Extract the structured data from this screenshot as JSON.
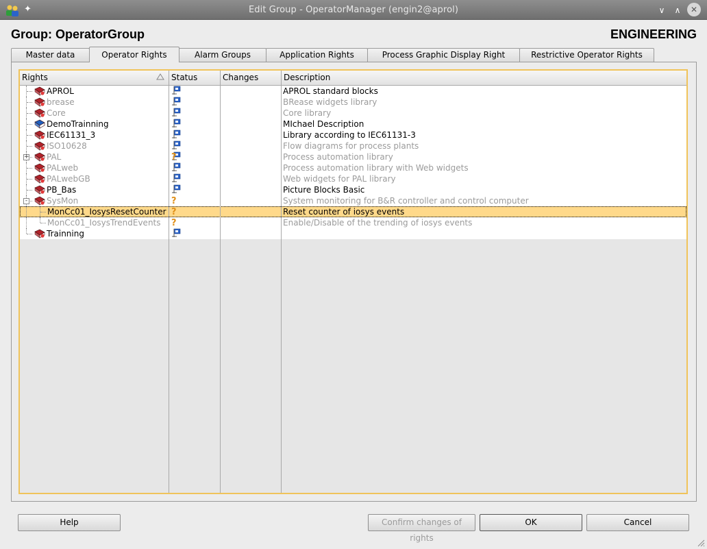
{
  "window": {
    "title": "Edit Group - OperatorManager (engin2@aprol)",
    "app_icon": "users-icon",
    "pin_icon": "pin-icon",
    "minimize_icon": "chevron-down-icon",
    "maximize_icon": "chevron-up-icon",
    "close_icon": "close-icon"
  },
  "header": {
    "group_title": "Group: OperatorGroup",
    "right_label": "ENGINEERING"
  },
  "tabs": [
    {
      "label": "Master data",
      "active": false
    },
    {
      "label": "Operator Rights",
      "active": true
    },
    {
      "label": "Alarm Groups",
      "active": false
    },
    {
      "label": "Application Rights",
      "active": false
    },
    {
      "label": "Process Graphic Display Right",
      "active": false
    },
    {
      "label": "Restrictive Operator Rights",
      "active": false
    }
  ],
  "table": {
    "columns": [
      "Rights",
      "Status",
      "Changes",
      "Description"
    ],
    "sort_column": "Rights",
    "rows": [
      {
        "name": "APROL",
        "status": "flag",
        "changes": "",
        "description": "APROL standard blocks",
        "greyed": false,
        "icon": "red-book-icon"
      },
      {
        "name": "brease",
        "status": "flag",
        "changes": "",
        "description": "BRease widgets library",
        "greyed": true,
        "icon": "red-book-icon"
      },
      {
        "name": "Core",
        "status": "flag",
        "changes": "",
        "description": "Core library",
        "greyed": true,
        "icon": "red-book-icon"
      },
      {
        "name": "DemoTrainning",
        "status": "flag",
        "changes": "",
        "description": "MIchael Description",
        "greyed": false,
        "icon": "blue-book-icon"
      },
      {
        "name": "IEC61131_3",
        "status": "flag",
        "changes": "",
        "description": "Library according to IEC61131-3",
        "greyed": false,
        "icon": "red-book-icon"
      },
      {
        "name": "ISO10628",
        "status": "flag",
        "changes": "",
        "description": "Flow diagrams for process plants",
        "greyed": true,
        "icon": "red-book-icon"
      },
      {
        "name": "PAL",
        "status": "question-flag",
        "changes": "",
        "description": "Process automation library",
        "greyed": true,
        "icon": "red-book-icon",
        "expander": "+"
      },
      {
        "name": "PALweb",
        "status": "flag",
        "changes": "",
        "description": "Process automation library with Web widgets",
        "greyed": true,
        "icon": "red-book-icon"
      },
      {
        "name": "PALwebGB",
        "status": "flag",
        "changes": "",
        "description": "Web widgets for PAL library",
        "greyed": true,
        "icon": "red-book-icon"
      },
      {
        "name": "PB_Bas",
        "status": "flag",
        "changes": "",
        "description": "Picture Blocks Basic",
        "greyed": false,
        "icon": "red-book-icon"
      },
      {
        "name": "SysMon",
        "status": "question",
        "changes": "",
        "description": "System monitoring for B&R controller and control computer",
        "greyed": true,
        "icon": "red-book-icon",
        "expander": "-"
      },
      {
        "name": "MonCc01_IosysResetCounter",
        "status": "question",
        "changes": "",
        "description": "Reset counter of iosys events",
        "greyed": false,
        "icon": "",
        "child": true,
        "selected": true
      },
      {
        "name": "MonCc01_IosysTrendEvents",
        "status": "question",
        "changes": "",
        "description": "Enable/Disable of the trending of iosys events",
        "greyed": true,
        "icon": "",
        "child": true
      },
      {
        "name": "Trainning",
        "status": "flag",
        "changes": "",
        "description": "",
        "greyed": false,
        "icon": "red-book-icon"
      }
    ]
  },
  "buttons": {
    "help": "Help",
    "confirm": "Confirm changes of rights",
    "ok": "OK",
    "cancel": "Cancel"
  },
  "colors": {
    "selection": "#ffd98a",
    "frame_accent": "#f0c35a",
    "book_red": "#b0222a",
    "book_blue": "#1e5fbf"
  }
}
